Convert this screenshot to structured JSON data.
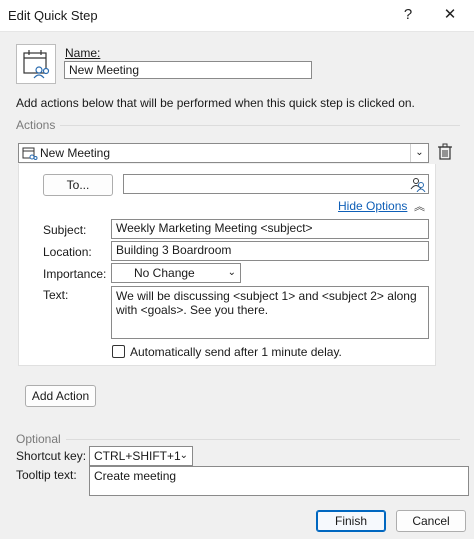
{
  "window": {
    "title": "Edit Quick Step",
    "help_glyph": "?",
    "close_glyph": "✕"
  },
  "name_label": "Name:",
  "name_value": "New Meeting",
  "description": "Add actions below that will be performed when this quick step is clicked on.",
  "actions_group": "Actions",
  "action_type": "New Meeting",
  "to_button": "To...",
  "to_value": "",
  "hide_options": "Hide Options",
  "subject_label": "Subject:",
  "subject_value": "Weekly Marketing Meeting <subject>",
  "location_label": "Location:",
  "location_value": "Building 3 Boardroom",
  "importance_label": "Importance:",
  "importance_value": "No Change",
  "text_label": "Text:",
  "text_value": "We will be discussing <subject 1> and <subject 2> along with <goals>. See you there.",
  "auto_send_label": "Automatically send after 1 minute delay.",
  "auto_send_checked": false,
  "add_action_button": "Add Action",
  "optional_group": "Optional",
  "shortcut_label": "Shortcut key:",
  "shortcut_value": "CTRL+SHIFT+1",
  "tooltip_label": "Tooltip text:",
  "tooltip_value": "Create meeting",
  "finish_button": "Finish",
  "cancel_button": "Cancel",
  "icons": [
    "calendar-people-icon",
    "delete-icon",
    "address-book-icon",
    "chevron-up-icon",
    "chevron-down-icon"
  ]
}
